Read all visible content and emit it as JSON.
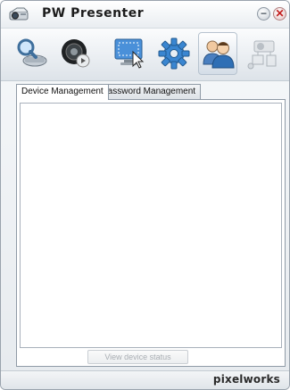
{
  "window": {
    "title": "PW Presenter",
    "minimize_glyph": "−",
    "close_glyph": "✕"
  },
  "toolbar": {
    "items": [
      {
        "icon": "search-projector-icon",
        "label": "Search"
      },
      {
        "icon": "camera-media-icon",
        "label": "Media"
      },
      {
        "icon": "screen-capture-icon",
        "label": "Screen"
      },
      {
        "icon": "gear-icon",
        "label": "Settings"
      },
      {
        "icon": "users-icon",
        "label": "Users"
      },
      {
        "icon": "network-projector-icon",
        "label": "Network"
      }
    ],
    "active_index": 4
  },
  "tabs": [
    {
      "label": "Device Management",
      "active": true
    },
    {
      "label": "Password Management",
      "active": false
    }
  ],
  "panel": {
    "view_button_label": "View device status"
  },
  "statusbar": {
    "text": "",
    "brand": "pixelworks"
  },
  "colors": {
    "close_red": "#c21d1d",
    "window_border": "#9aa3ad"
  }
}
